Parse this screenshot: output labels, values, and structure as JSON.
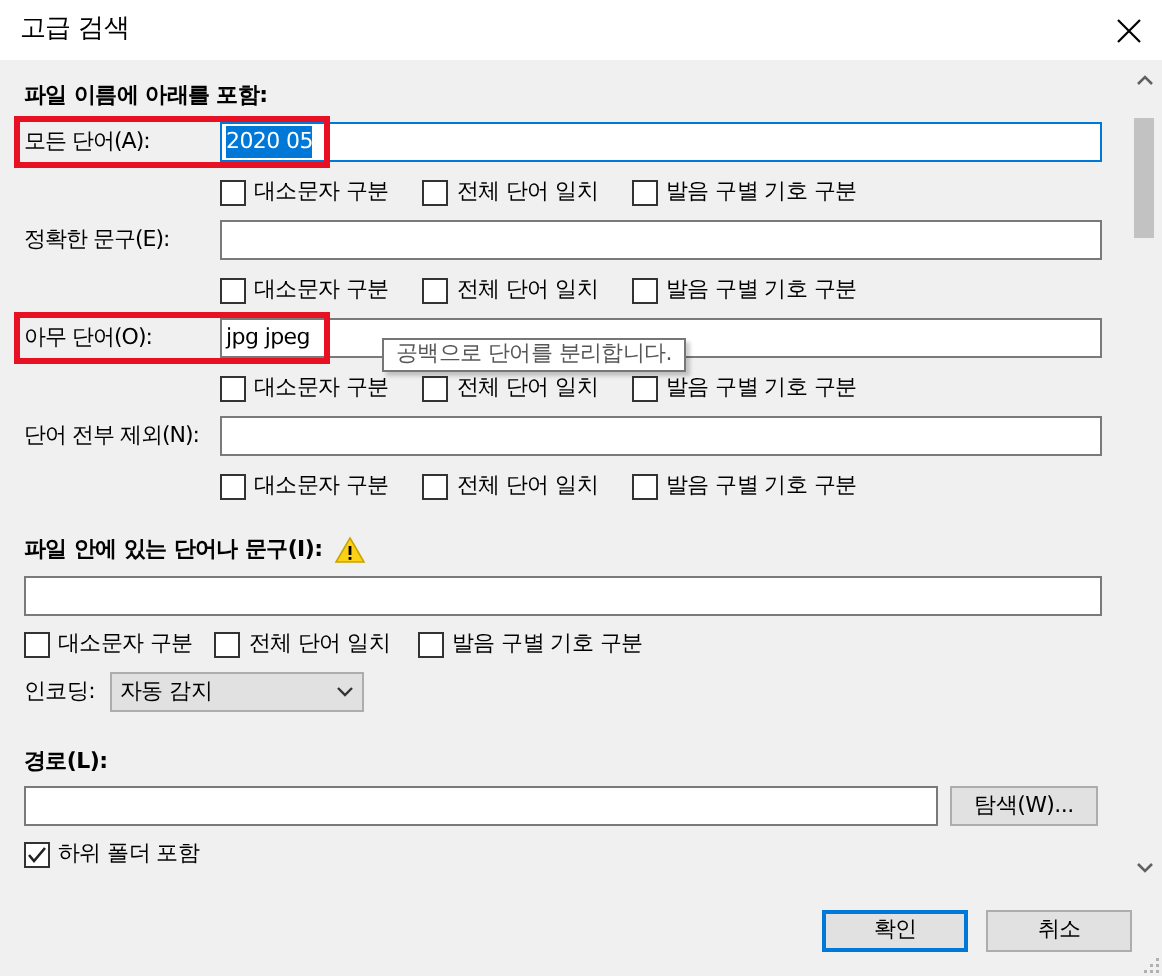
{
  "window": {
    "title": "고급 검색"
  },
  "filename_section": {
    "heading": "파일 이름에 아래를 포함:",
    "rows": [
      {
        "label": "모든 단어(A):",
        "value": "2020 05",
        "focused": true,
        "text_selected": true,
        "highlighted": true,
        "options": [
          {
            "label": "대소문자 구분",
            "checked": false
          },
          {
            "label": "전체 단어 일치",
            "checked": false
          },
          {
            "label": "발음 구별 기호 구분",
            "checked": false
          }
        ]
      },
      {
        "label": "정확한 문구(E):",
        "focused": false,
        "highlighted": false,
        "options": [
          {
            "label": "대소문자 구분",
            "checked": false
          },
          {
            "label": "전체 단어 일치",
            "checked": false
          },
          {
            "label": "발음 구별 기호 구분",
            "checked": false
          }
        ]
      },
      {
        "label": "아무 단어(O):",
        "value": "jpg jpeg",
        "focused": false,
        "highlighted": true,
        "tooltip": "공백으로 단어를 분리합니다.",
        "options": [
          {
            "label": "대소문자 구분",
            "checked": false
          },
          {
            "label": "전체 단어 일치",
            "checked": false
          },
          {
            "label": "발음 구별 기호 구분",
            "checked": false
          }
        ]
      },
      {
        "label": "단어 전부 제외(N):",
        "focused": false,
        "highlighted": false,
        "options": [
          {
            "label": "대소문자 구분",
            "checked": false
          },
          {
            "label": "전체 단어 일치",
            "checked": false
          },
          {
            "label": "발음 구별 기호 구분",
            "checked": false
          }
        ]
      }
    ]
  },
  "content_section": {
    "heading": "파일 안에 있는 단어나 문구(I):",
    "options": [
      {
        "label": "대소문자 구분",
        "checked": false
      },
      {
        "label": "전체 단어 일치",
        "checked": false
      },
      {
        "label": "발음 구별 기호 구분",
        "checked": false
      }
    ],
    "encoding": {
      "label": "인코딩:",
      "value": "자동 감지"
    }
  },
  "path_section": {
    "heading": "경로(L):",
    "browse_button": "탐색(W)...",
    "subfolders": {
      "label": "하위 폴더 포함",
      "checked": true
    }
  },
  "buttons": [
    {
      "label": "확인",
      "default": true
    },
    {
      "label": "취소",
      "default": false
    }
  ]
}
